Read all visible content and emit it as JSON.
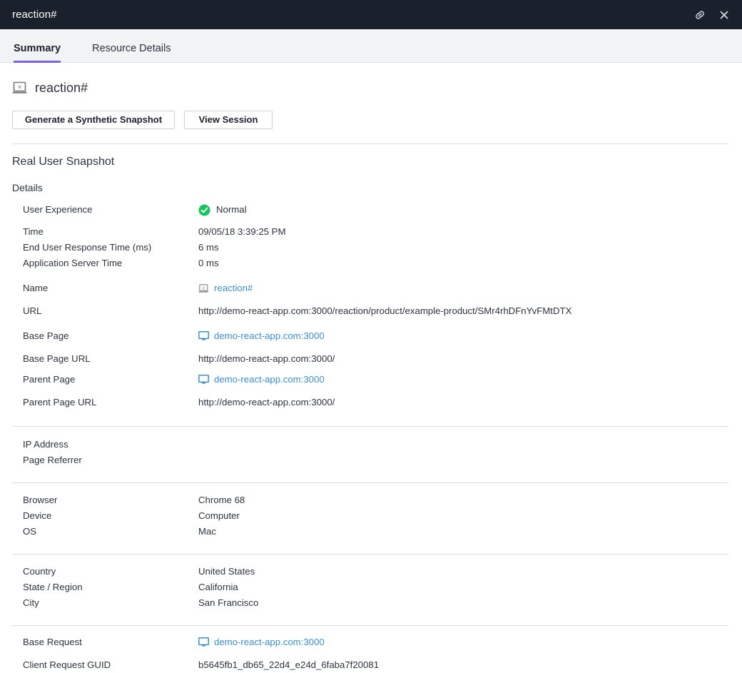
{
  "titlebar": {
    "title": "reaction#",
    "link_icon": "link-icon",
    "close_icon": "close-icon"
  },
  "tabs": [
    {
      "label": "Summary",
      "active": true
    },
    {
      "label": "Resource Details",
      "active": false
    }
  ],
  "header": {
    "icon": "laptop-icon",
    "title": "reaction#",
    "buttons": [
      {
        "label": "Generate a Synthetic Snapshot"
      },
      {
        "label": "View Session"
      }
    ]
  },
  "section": {
    "title": "Real User Snapshot",
    "subtitle": "Details"
  },
  "details": {
    "group1": [
      {
        "label": "User Experience",
        "value": "Normal",
        "type": "status",
        "status_color": "#17c45e"
      }
    ],
    "group2": [
      {
        "label": "Time",
        "value": "09/05/18 3:39:25 PM",
        "type": "text"
      },
      {
        "label": "End User Response Time (ms)",
        "value": "6 ms",
        "type": "text"
      },
      {
        "label": "Application Server Time",
        "value": "0 ms",
        "type": "text"
      }
    ],
    "group3": [
      {
        "label": "Name",
        "value": "reaction#",
        "type": "link-laptop"
      },
      {
        "label": "URL",
        "value": "http://demo-react-app.com:3000/reaction/product/example-product/SMr4rhDFnYvFMtDTX",
        "type": "text"
      }
    ],
    "group4": [
      {
        "label": "Base Page",
        "value": "demo-react-app.com:3000",
        "type": "link-monitor"
      },
      {
        "label": "Base Page URL",
        "value": "http://demo-react-app.com:3000/",
        "type": "text"
      },
      {
        "label": "Parent Page",
        "value": "demo-react-app.com:3000",
        "type": "link-monitor"
      },
      {
        "label": "Parent Page URL",
        "value": "http://demo-react-app.com:3000/",
        "type": "text"
      }
    ],
    "group5": [
      {
        "label": "IP Address",
        "value": "",
        "type": "text"
      },
      {
        "label": "Page Referrer",
        "value": "",
        "type": "text"
      }
    ],
    "group6": [
      {
        "label": "Browser",
        "value": "Chrome 68",
        "type": "text"
      },
      {
        "label": "Device",
        "value": "Computer",
        "type": "text"
      },
      {
        "label": "OS",
        "value": "Mac",
        "type": "text"
      }
    ],
    "group7": [
      {
        "label": "Country",
        "value": "United States",
        "type": "text"
      },
      {
        "label": "State / Region",
        "value": "California",
        "type": "text"
      },
      {
        "label": "City",
        "value": "San Francisco",
        "type": "text"
      }
    ],
    "group8": [
      {
        "label": "Base Request",
        "value": "demo-react-app.com:3000",
        "type": "link-monitor"
      },
      {
        "label": "Client Request GUID",
        "value": "b5645fb1_db65_22d4_e24d_6faba7f20081",
        "type": "text"
      }
    ]
  },
  "colors": {
    "titlebar_bg": "#1b212c",
    "tab_accent": "#7b61e8",
    "link": "#3b8fd4",
    "status_ok": "#17c45e"
  }
}
